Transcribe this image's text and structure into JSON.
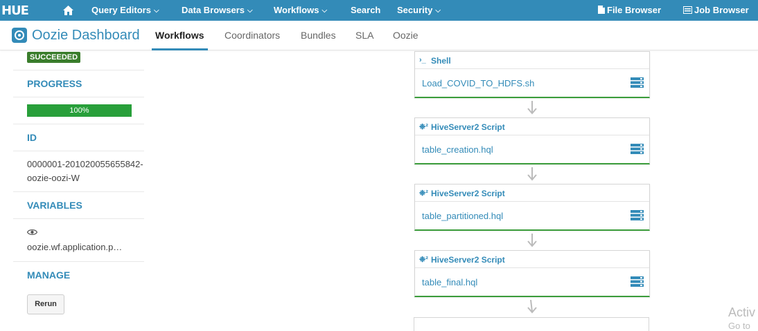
{
  "topnav": {
    "logo": "HUE",
    "items": [
      {
        "label": "Query Editors",
        "dropdown": true
      },
      {
        "label": "Data Browsers",
        "dropdown": true
      },
      {
        "label": "Workflows",
        "dropdown": true
      },
      {
        "label": "Search",
        "dropdown": false
      },
      {
        "label": "Security",
        "dropdown": true
      }
    ],
    "right": [
      {
        "label": "File Browser",
        "icon": "file-icon"
      },
      {
        "label": "Job Browser",
        "icon": "list-icon"
      }
    ]
  },
  "subnav": {
    "title": "Oozie Dashboard",
    "tabs": [
      "Workflows",
      "Coordinators",
      "Bundles",
      "SLA",
      "Oozie"
    ],
    "active_tab": "Workflows"
  },
  "sidebar": {
    "status_badge": "SUCCEEDED",
    "progress_header": "PROGRESS",
    "progress_value": 100,
    "progress_label": "100%",
    "id_header": "ID",
    "id_value": "0000001-201020055655842-oozie-oozi-W",
    "variables_header": "VARIABLES",
    "variable_value": "oozie.wf.application.p…",
    "manage_header": "MANAGE",
    "rerun_label": "Rerun"
  },
  "graph": {
    "nodes": [
      {
        "type": "Shell",
        "icon": "shell-icon",
        "file": "Load_COVID_TO_HDFS.sh"
      },
      {
        "type": "HiveServer2 Script",
        "icon": "hive-icon",
        "file": "table_creation.hql"
      },
      {
        "type": "HiveServer2 Script",
        "icon": "hive-icon",
        "file": "table_partitioned.hql"
      },
      {
        "type": "HiveServer2 Script",
        "icon": "hive-icon",
        "file": "table_final.hql"
      }
    ]
  },
  "watermark": {
    "line1": "Activ",
    "line2": "Go to"
  },
  "colors": {
    "brand": "#338bb8",
    "success": "#3a7d2c",
    "progress": "#289f3a"
  }
}
